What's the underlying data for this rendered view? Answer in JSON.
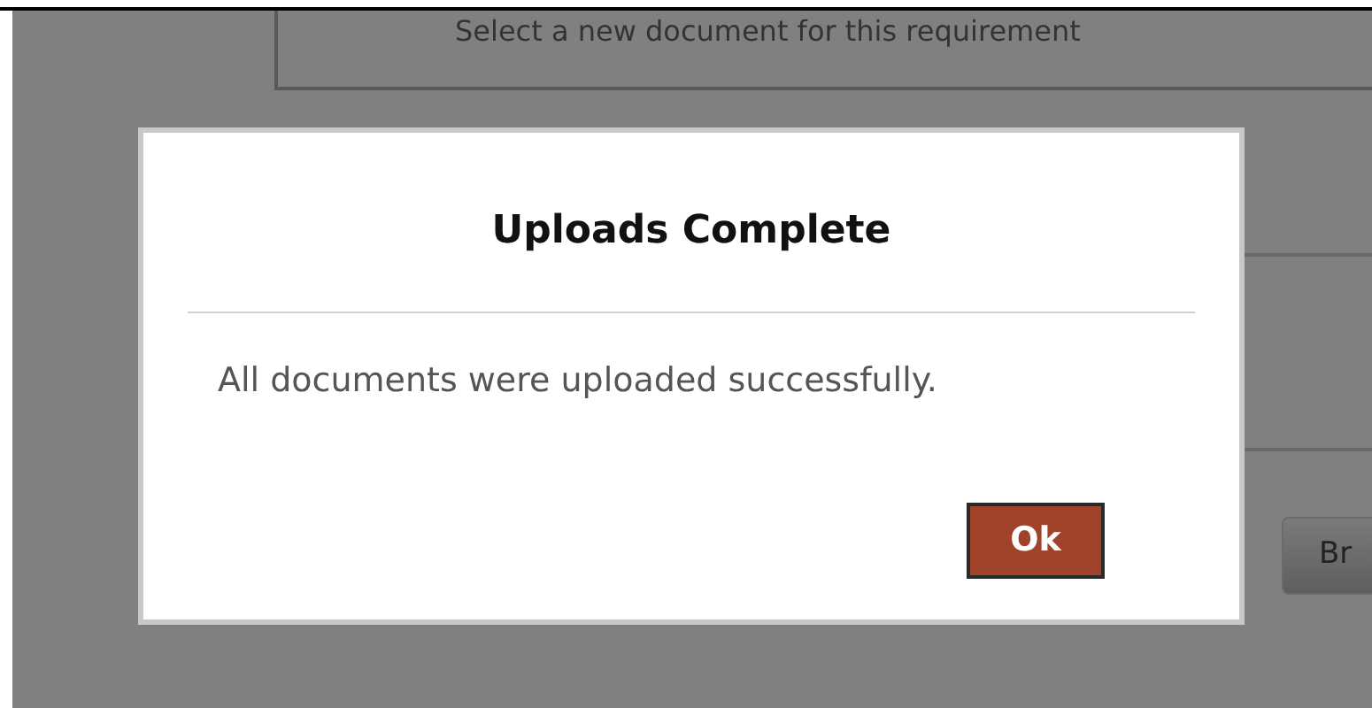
{
  "background": {
    "prompt": "Select a new document for this requirement",
    "button": "Br"
  },
  "dialog": {
    "title": "Uploads Complete",
    "message": "All documents were uploaded successfully.",
    "buttons": [
      "Ok"
    ]
  }
}
